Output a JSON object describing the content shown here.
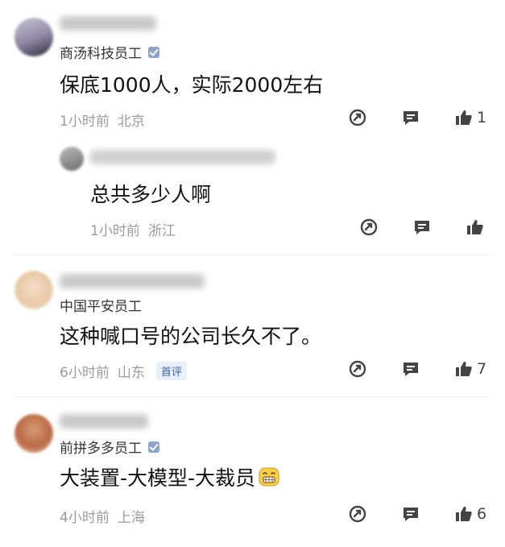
{
  "comments": [
    {
      "tag": "商汤科技员工",
      "text": "保底1000人，实际2000左右",
      "time": "1小时前",
      "location": "北京",
      "likes": "1",
      "reply": {
        "text": "总共多少人啊",
        "time": "1小时前",
        "location": "浙江",
        "likes": ""
      }
    },
    {
      "tag": "中国平安员工",
      "text": "这种喊口号的公司长久不了。",
      "time": "6小时前",
      "location": "山东",
      "badge": "首评",
      "likes": "7"
    },
    {
      "tag": "前拼多多员工",
      "text": "大装置-大模型-大裁员",
      "time": "4小时前",
      "location": "上海",
      "likes": "6"
    }
  ],
  "icons": {
    "share": "share-icon",
    "reply": "comment-icon",
    "like": "thumbs-up-icon",
    "emoji": "grinning-emoji"
  },
  "colors": {
    "badge_bg": "#eaf0fb",
    "badge_text": "#3b5fa8",
    "meta_text": "#9a9a9a",
    "verified": "#8fa3c7"
  }
}
